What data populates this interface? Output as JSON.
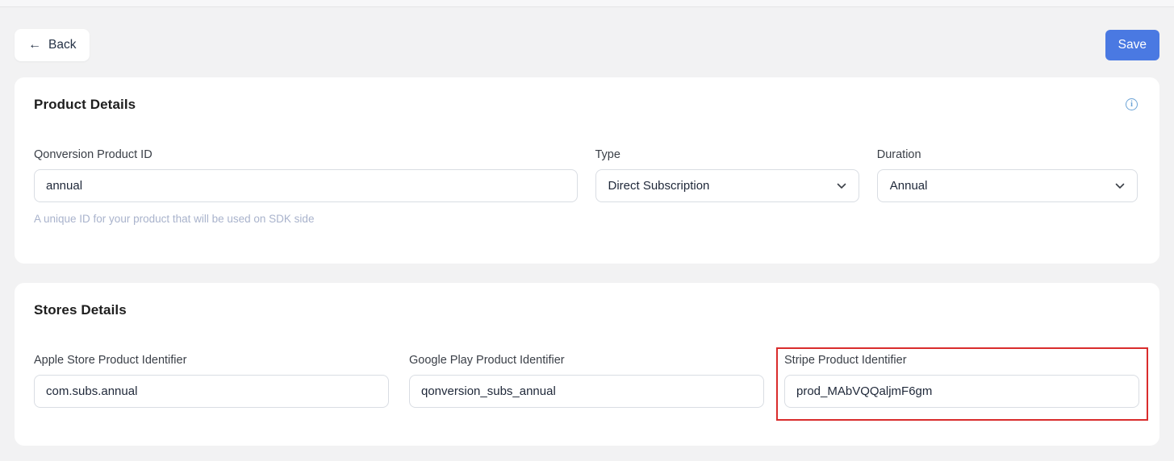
{
  "colors": {
    "page_background": "#f2f2f3",
    "save_button": "#4a79e2",
    "highlight_red": "#d92c2c",
    "info_icon_blue": "#6ba3d6",
    "helper_text": "#a9b3cc"
  },
  "toolbar": {
    "back_label": "Back",
    "back_arrow": "←",
    "save_label": "Save"
  },
  "product_details": {
    "title": "Product Details",
    "product_id": {
      "label": "Qonversion Product ID",
      "value": "annual",
      "helper": "A unique ID for your product that will be used on SDK side"
    },
    "type": {
      "label": "Type",
      "value": "Direct Subscription"
    },
    "duration": {
      "label": "Duration",
      "value": "Annual"
    }
  },
  "stores_details": {
    "title": "Stores Details",
    "apple": {
      "label": "Apple Store Product Identifier",
      "value": "com.subs.annual"
    },
    "google": {
      "label": "Google Play Product Identifier",
      "value": "qonversion_subs_annual"
    },
    "stripe": {
      "label": "Stripe Product Identifier",
      "value": "prod_MAbVQQaljmF6gm"
    }
  },
  "icons": {
    "info": "i"
  }
}
